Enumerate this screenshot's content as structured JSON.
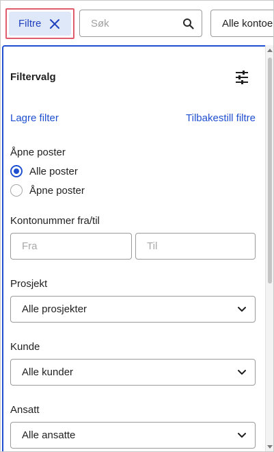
{
  "topbar": {
    "filter_chip_label": "Filtre",
    "search_placeholder": "Søk",
    "accounts_select_value": "Alle kontoer"
  },
  "panel": {
    "title": "Filtervalg",
    "save_filter_link": "Lagre filter",
    "reset_filters_link": "Tilbakestill filtre",
    "open_entries": {
      "label": "Åpne poster",
      "options": [
        {
          "label": "Alle poster",
          "checked": true
        },
        {
          "label": "Åpne poster",
          "checked": false
        }
      ]
    },
    "account_range": {
      "label": "Kontonummer fra/til",
      "from_placeholder": "Fra",
      "to_placeholder": "Til"
    },
    "project": {
      "label": "Prosjekt",
      "value": "Alle prosjekter"
    },
    "customer": {
      "label": "Kunde",
      "value": "Alle kunder"
    },
    "employee": {
      "label": "Ansatt",
      "value": "Alle ansatte"
    }
  },
  "colors": {
    "accent": "#1f4fd1",
    "chip_background": "#dfe8f8",
    "chip_highlight_border": "#e05c6c",
    "field_border": "#9a9a9a"
  }
}
